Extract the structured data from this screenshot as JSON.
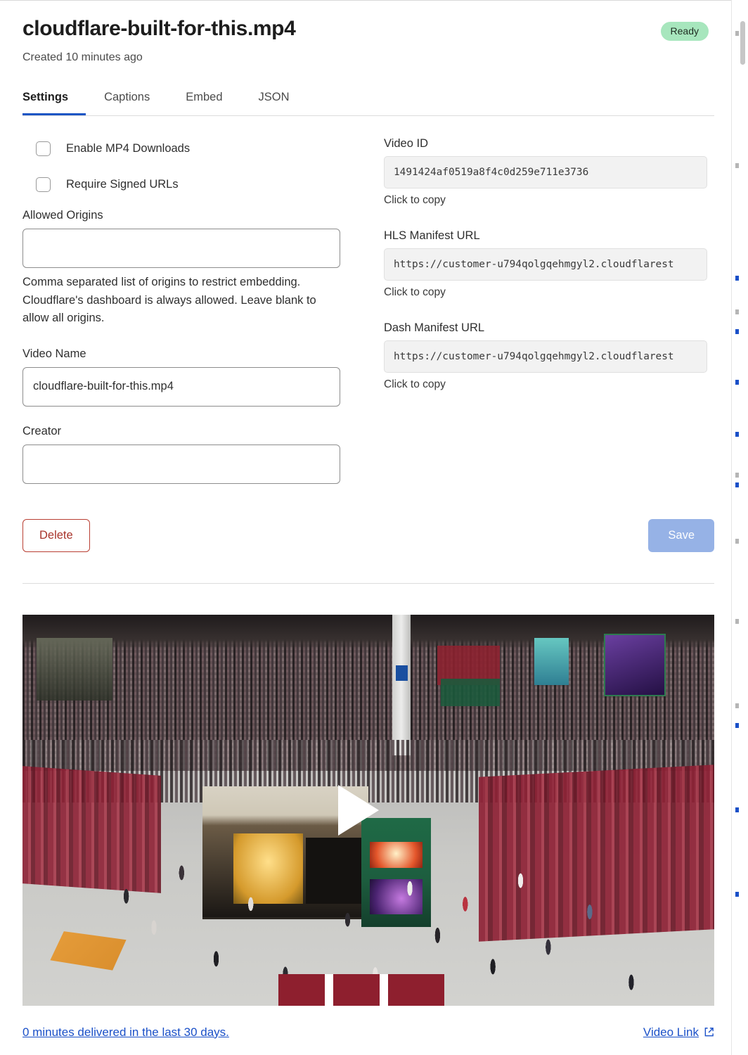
{
  "header": {
    "title": "cloudflare-built-for-this.mp4",
    "created": "Created 10 minutes ago",
    "status_badge": "Ready",
    "status_color": "#a7e6bd"
  },
  "tabs": [
    {
      "label": "Settings",
      "active": true
    },
    {
      "label": "Captions",
      "active": false
    },
    {
      "label": "Embed",
      "active": false
    },
    {
      "label": "JSON",
      "active": false
    }
  ],
  "settings": {
    "checkboxes": [
      {
        "label": "Enable MP4 Downloads",
        "checked": false
      },
      {
        "label": "Require Signed URLs",
        "checked": false
      }
    ],
    "allowed_origins": {
      "label": "Allowed Origins",
      "value": "",
      "help": "Comma separated list of origins to restrict embedding. Cloudflare's dashboard is always allowed. Leave blank to allow all origins."
    },
    "video_name": {
      "label": "Video Name",
      "value": "cloudflare-built-for-this.mp4"
    },
    "creator": {
      "label": "Creator",
      "value": ""
    },
    "delete_label": "Delete",
    "save_label": "Save"
  },
  "details": {
    "video_id": {
      "label": "Video ID",
      "value": "1491424af0519a8f4c0d259e711e3736",
      "hint": "Click to copy"
    },
    "hls_manifest": {
      "label": "HLS Manifest URL",
      "value": "https://customer-u794qolgqehmgyl2.cloudflarest",
      "hint": "Click to copy"
    },
    "dash_manifest": {
      "label": "Dash Manifest URL",
      "value": "https://customer-u794qolgqehmgyl2.cloudflarest",
      "hint": "Click to copy"
    }
  },
  "player": {
    "play_icon": "play-triangle-icon"
  },
  "footer": {
    "analytics_link": "0 minutes delivered in the last 30 days.",
    "video_link": "Video Link",
    "external_icon": "external-link-icon",
    "link_color": "#1a50c8"
  }
}
